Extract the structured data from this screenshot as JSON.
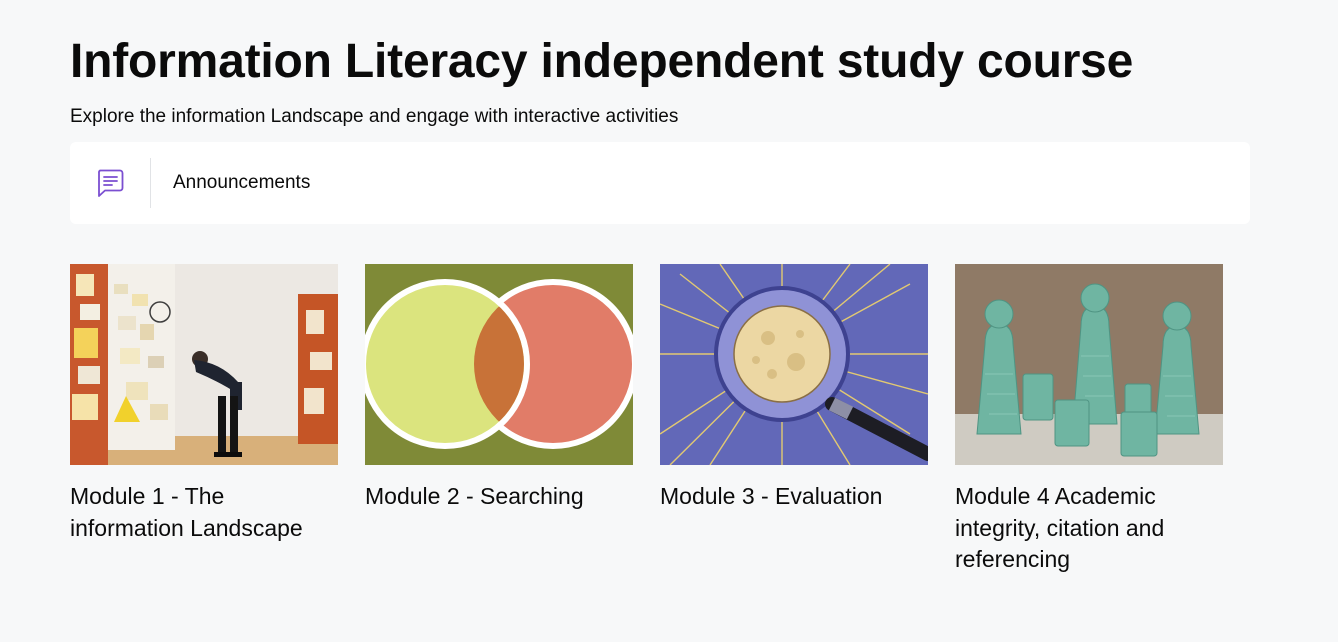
{
  "header": {
    "title": "Information Literacy independent study course",
    "subtitle": "Explore the information Landscape and engage with interactive activities"
  },
  "announcements": {
    "label": "Announcements",
    "icon": "chat-bubble-icon",
    "icon_color": "#7b4fd1"
  },
  "modules": [
    {
      "label": "Module 1 - The information Landscape",
      "image": "person-looking-at-noticeboard"
    },
    {
      "label": "Module 2 - Searching",
      "image": "venn-diagram"
    },
    {
      "label": "Module 3 - Evaluation",
      "image": "magnifying-glass-over-moon"
    },
    {
      "label": "Module 4 Academic integrity, citation and referencing",
      "image": "green-glass-bottles"
    }
  ],
  "colors": {
    "background": "#f7f8f9",
    "panel": "#ffffff",
    "text": "#0b0b0b"
  }
}
